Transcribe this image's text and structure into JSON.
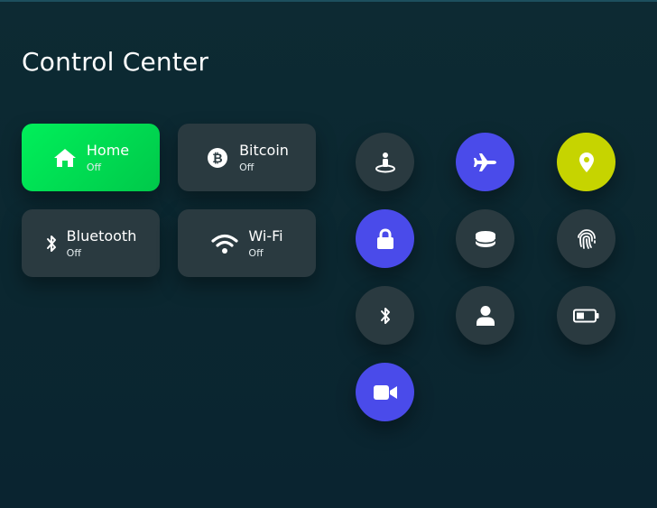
{
  "header": {
    "title": "Control Center"
  },
  "tiles": [
    {
      "name": "Home",
      "status": "Off",
      "icon": "home-icon",
      "active": true
    },
    {
      "name": "Bitcoin",
      "status": "Off",
      "icon": "bitcoin-icon",
      "active": false
    },
    {
      "name": "Bluetooth",
      "status": "Off",
      "icon": "bluetooth-icon",
      "active": false
    },
    {
      "name": "Wi-Fi",
      "status": "Off",
      "icon": "wifi-icon",
      "active": false
    }
  ],
  "toggles": [
    {
      "icon": "street-view-icon",
      "color": "#2a3a40"
    },
    {
      "icon": "airplane-icon",
      "color": "#4a4bea"
    },
    {
      "icon": "location-pin-icon",
      "color": "#c6d400"
    },
    {
      "icon": "lock-icon",
      "color": "#4a4bea"
    },
    {
      "icon": "database-icon",
      "color": "#2a3a40"
    },
    {
      "icon": "fingerprint-icon",
      "color": "#2a3a40"
    },
    {
      "icon": "bluetooth-icon",
      "color": "#2a3a40"
    },
    {
      "icon": "user-icon",
      "color": "#2a3a40"
    },
    {
      "icon": "battery-icon",
      "color": "#2a3a40"
    },
    {
      "icon": "video-camera-icon",
      "color": "#4a4bea"
    }
  ],
  "colors": {
    "background": "#0b2730",
    "tile": "#2a3a40",
    "active_green": "#00e054",
    "accent_blue": "#4a4bea",
    "accent_lime": "#c6d400"
  }
}
